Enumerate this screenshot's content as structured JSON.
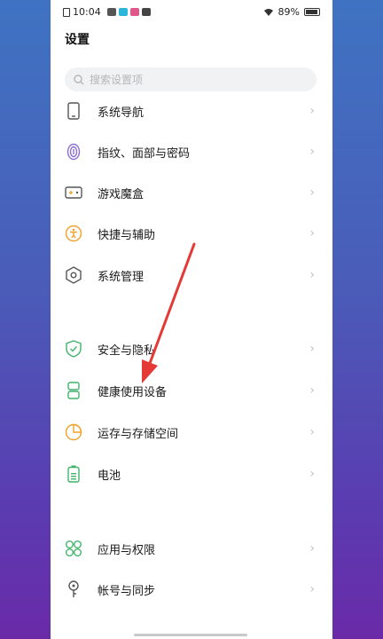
{
  "status_bar": {
    "time": "10:04",
    "battery": "89%"
  },
  "page": {
    "title": "设置"
  },
  "search": {
    "placeholder": "搜索设置项"
  },
  "items": [
    {
      "label": "系统导航",
      "icon": "phone-nav-icon"
    },
    {
      "label": "指纹、面部与密码",
      "icon": "fingerprint-icon"
    },
    {
      "label": "游戏魔盒",
      "icon": "gamepad-icon"
    },
    {
      "label": "快捷与辅助",
      "icon": "accessibility-icon"
    },
    {
      "label": "系统管理",
      "icon": "hexagon-gear-icon"
    },
    {
      "label": "安全与隐私",
      "icon": "shield-check-icon"
    },
    {
      "label": "健康使用设备",
      "icon": "hourglass-icon"
    },
    {
      "label": "运存与存储空间",
      "icon": "pie-storage-icon"
    },
    {
      "label": "电池",
      "icon": "battery-icon"
    },
    {
      "label": "应用与权限",
      "icon": "apps-grid-icon"
    },
    {
      "label": "帐号与同步",
      "icon": "key-account-icon"
    }
  ],
  "chevron": "›",
  "colors": {
    "accent_green": "#3fb46a",
    "accent_orange": "#f0a12a",
    "accent_purple": "#8a6fd1",
    "annotation_arrow": "#e53935"
  }
}
